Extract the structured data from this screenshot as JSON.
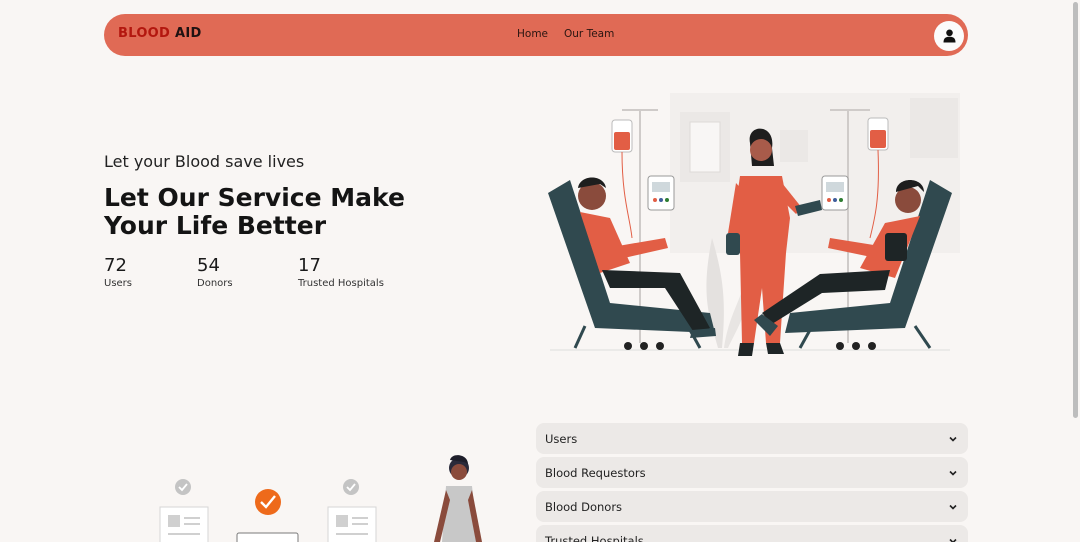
{
  "navbar": {
    "brand_part1": "BLOOD",
    "brand_part2": "AID",
    "links": [
      {
        "label": "Home"
      },
      {
        "label": "Our Team"
      }
    ],
    "user_icon": "user-icon"
  },
  "hero": {
    "tagline": "Let your Blood save lives",
    "headline": "Let Our Service Make Your Life Better",
    "stats": [
      {
        "value": "72",
        "label": "Users"
      },
      {
        "value": "54",
        "label": "Donors"
      },
      {
        "value": "17",
        "label": "Trusted Hospitals"
      }
    ]
  },
  "accordion": {
    "items": [
      {
        "label": "Users"
      },
      {
        "label": "Blood Requestors"
      },
      {
        "label": "Blood Donors"
      },
      {
        "label": "Trusted Hospitals"
      }
    ]
  },
  "colors": {
    "accent": "#e06a55",
    "brand_red": "#b3170f",
    "background": "#f9f6f4",
    "check_orange": "#ee6a1b"
  }
}
